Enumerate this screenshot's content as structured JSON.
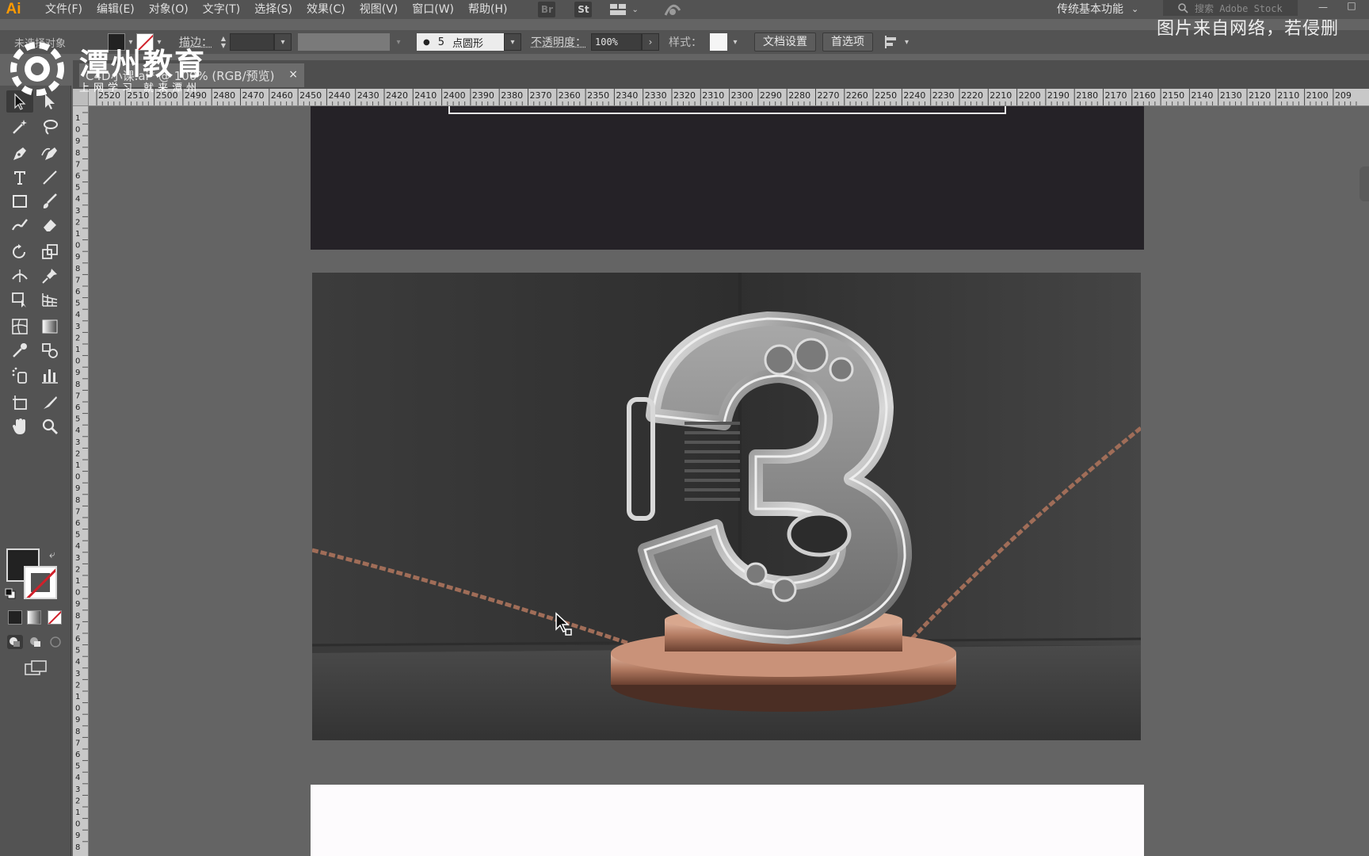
{
  "app": {
    "logo": "Ai",
    "menu": [
      "文件(F)",
      "编辑(E)",
      "对象(O)",
      "文字(T)",
      "选择(S)",
      "效果(C)",
      "视图(V)",
      "窗口(W)",
      "帮助(H)"
    ],
    "bridge_label": "Br",
    "stock_label": "St",
    "workspace": "传统基本功能",
    "search_placeholder": "搜索 Adobe Stock",
    "window_minimize": "—",
    "window_maximize": "□"
  },
  "control_bar": {
    "selection_status": "未选择对象",
    "stroke_label": "描边：",
    "brush_size": "5",
    "brush_name": "点圆形",
    "opacity_label": "不透明度：",
    "opacity_value": "100%",
    "style_label": "样式：",
    "doc_setup": "文档设置",
    "preferences": "首选项"
  },
  "document": {
    "tab_title": "C4D小课.ai* @ 100% (RGB/预览)",
    "tab_close": "×"
  },
  "watermark": {
    "title": "潭州教育",
    "subtitle": "上网学习 就来潭州",
    "notice": "图片来自网络，若侵删"
  },
  "ruler": {
    "h_labels": [
      "2520",
      "2510",
      "2500",
      "2490",
      "2480",
      "2470",
      "2460",
      "2450",
      "2440",
      "2430",
      "2420",
      "2410",
      "2400",
      "2390",
      "2380",
      "2370",
      "2360",
      "2350",
      "2340",
      "2330",
      "2320",
      "2310",
      "2300",
      "2290",
      "2280",
      "2270",
      "2260",
      "2250",
      "2240",
      "2230",
      "2220",
      "2210",
      "2200",
      "2190",
      "2180",
      "2170",
      "2160",
      "2150",
      "2140",
      "2130",
      "2120",
      "2110",
      "2100",
      "209"
    ],
    "v_labels": [
      "1",
      "0",
      "9",
      "8",
      "7",
      "6",
      "5",
      "4",
      "3",
      "2",
      "1",
      "0",
      "9",
      "8",
      "7",
      "6",
      "5",
      "4",
      "3",
      "2",
      "1",
      "0",
      "9",
      "8",
      "7",
      "6",
      "5",
      "4",
      "3",
      "2",
      "1",
      "0",
      "9",
      "8",
      "7",
      "6",
      "5",
      "4",
      "3",
      "2",
      "1",
      "0",
      "9",
      "8",
      "7",
      "6",
      "5",
      "4",
      "3",
      "2",
      "1",
      "0",
      "9",
      "8",
      "7",
      "6",
      "5",
      "4",
      "3",
      "2",
      "1",
      "0",
      "9",
      "8"
    ]
  },
  "colors": {
    "accent": "#ff9a00",
    "panel": "#535353",
    "canvas": "#646464",
    "copper": "#b57a62",
    "dark_artboard": "#252227"
  },
  "tools": [
    "selection-tool",
    "direct-selection-tool",
    "magic-wand-tool",
    "lasso-tool",
    "pen-tool",
    "curvature-tool",
    "type-tool",
    "line-tool",
    "rectangle-tool",
    "paintbrush-tool",
    "shaper-tool",
    "eraser-tool",
    "rotate-tool",
    "scale-tool",
    "width-tool",
    "puppet-warp-tool",
    "free-transform-tool",
    "perspective-grid-tool",
    "mesh-tool",
    "gradient-tool",
    "eyedropper-tool",
    "blend-tool",
    "symbol-sprayer-tool",
    "column-graph-tool",
    "artboard-tool",
    "slice-tool",
    "hand-tool",
    "zoom-tool"
  ],
  "artwork": {
    "numeral": "3"
  }
}
